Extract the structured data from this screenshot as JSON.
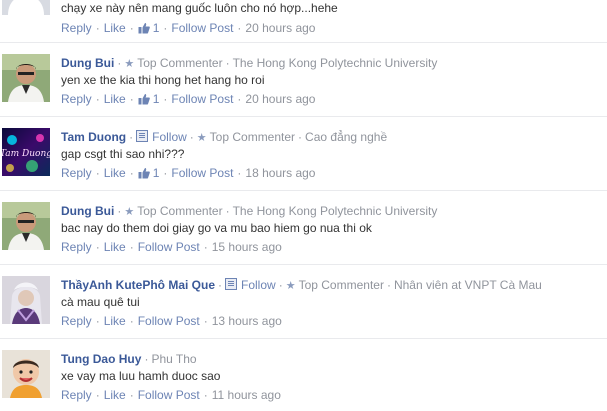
{
  "comments": [
    {
      "author": "",
      "follow": "",
      "badge": "",
      "affiliation": "",
      "text": "chạy xe này nên mang guốc luôn cho nó hợp...hehe",
      "reply": "Reply",
      "like": "Like",
      "like_count": "1",
      "follow_post": "Follow Post",
      "time": "20 hours ago"
    },
    {
      "author": "Dung Bui",
      "follow": "",
      "badge": "Top Commenter",
      "affiliation": "The Hong Kong Polytechnic University",
      "text": "yen xe the kia thi hong het hang ho roi",
      "reply": "Reply",
      "like": "Like",
      "like_count": "1",
      "follow_post": "Follow Post",
      "time": "20 hours ago"
    },
    {
      "author": "Tam Duong",
      "follow": "Follow",
      "badge": "Top Commenter",
      "affiliation": "Cao đẳng nghề",
      "text": "gap csgt thi sao nhi???",
      "reply": "Reply",
      "like": "Like",
      "like_count": "1",
      "follow_post": "Follow Post",
      "time": "18 hours ago"
    },
    {
      "author": "Dung Bui",
      "follow": "",
      "badge": "Top Commenter",
      "affiliation": "The Hong Kong Polytechnic University",
      "text": "bac nay do them doi giay go va mu bao hiem go nua thi ok",
      "reply": "Reply",
      "like": "Like",
      "like_count": "",
      "follow_post": "Follow Post",
      "time": "15 hours ago"
    },
    {
      "author": "ThầyAnh KutePhô Mai Que",
      "follow": "Follow",
      "badge": "Top Commenter",
      "affiliation": "Nhân viên at VNPT Cà Mau",
      "text": "cà mau quê tui",
      "reply": "Reply",
      "like": "Like",
      "like_count": "",
      "follow_post": "Follow Post",
      "time": "13 hours ago"
    },
    {
      "author": "Tung Dao Huy",
      "follow": "",
      "badge": "",
      "affiliation": "Phu Tho",
      "text": "xe vay ma luu hamh duoc sao",
      "reply": "Reply",
      "like": "Like",
      "like_count": "",
      "follow_post": "Follow Post",
      "time": "11 hours ago"
    }
  ],
  "avatars": {
    "avatar_banner_text": "Tam Duong"
  },
  "colors": {
    "link": "#6d84b4",
    "author": "#3b5998",
    "meta": "#90949c",
    "text": "#333333"
  }
}
